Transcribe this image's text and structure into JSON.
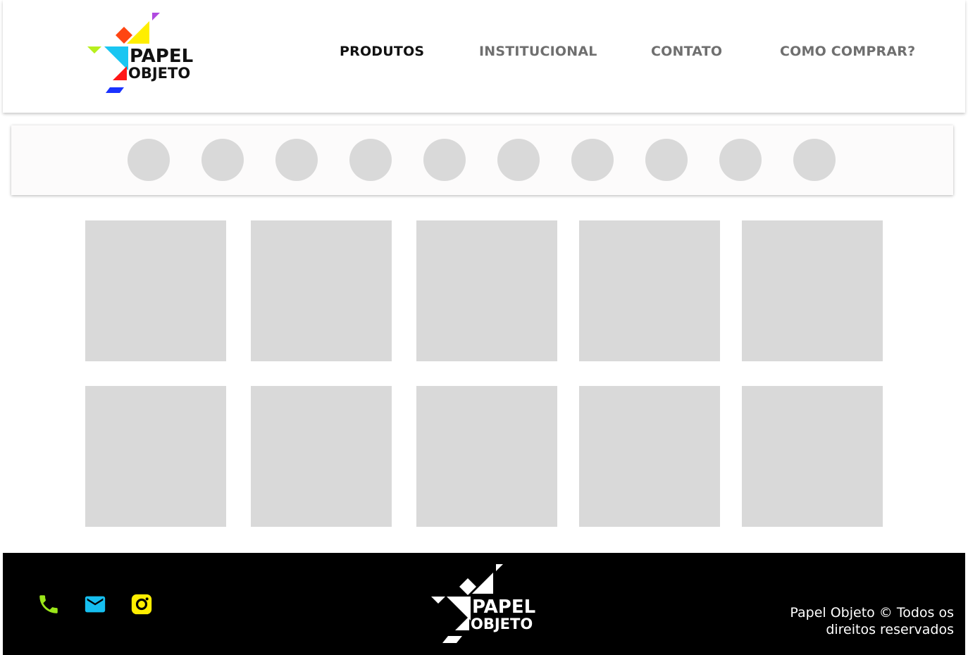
{
  "header": {
    "logo": {
      "line1": "PAPEL",
      "line2": "OBJETO",
      "colors": {
        "violet": "#b04ae0",
        "yellow": "#ffee00",
        "red_orange": "#ff4512",
        "cyan": "#19c6f2",
        "lime": "#b7ef1e",
        "red": "#ff1616",
        "blue": "#1a32ff",
        "text": "#111111"
      }
    },
    "nav": [
      {
        "label": "PRODUTOS",
        "active": true
      },
      {
        "label": "INSTITUCIONAL",
        "active": false
      },
      {
        "label": "CONTATO",
        "active": false
      },
      {
        "label": "COMO COMPRAR?",
        "active": false
      }
    ]
  },
  "categories": {
    "count": 10,
    "placeholder_color": "#d9d9d9"
  },
  "products": {
    "rows": 2,
    "per_row": 5,
    "placeholder_color": "#d9d9d9"
  },
  "footer": {
    "icons": [
      {
        "name": "phone-icon",
        "color": "#9be619"
      },
      {
        "name": "mail-icon",
        "color": "#16bff0"
      },
      {
        "name": "instagram-icon",
        "color": "#ffee00"
      }
    ],
    "logo": {
      "line1": "PAPEL",
      "line2": "OBJETO",
      "color": "#ffffff"
    },
    "copyright": "Papel Objeto © Todos os direitos reservados"
  }
}
